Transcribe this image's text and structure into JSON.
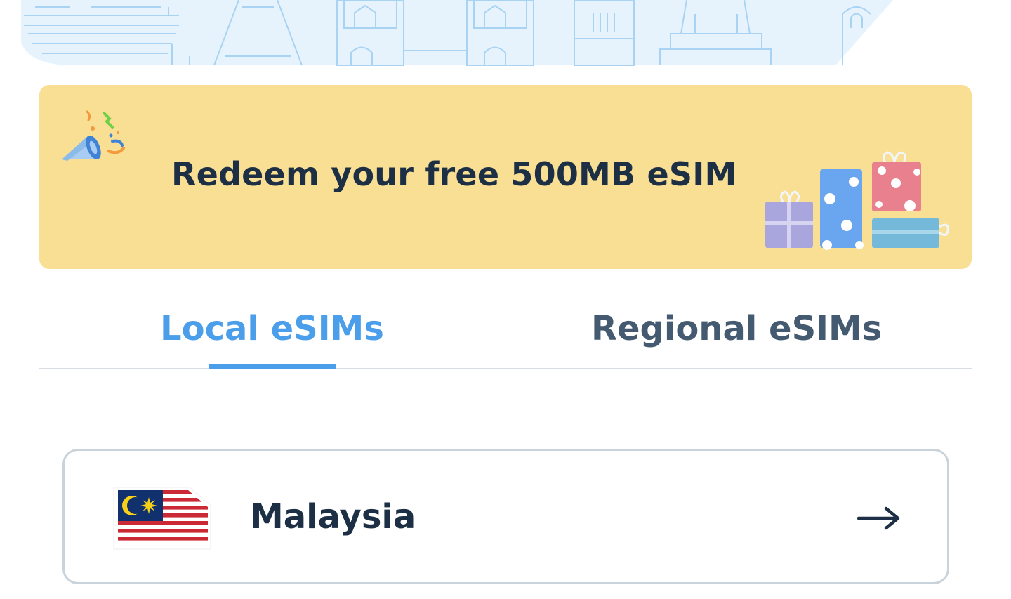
{
  "promo": {
    "title": "Redeem your free 500MB eSIM"
  },
  "tabs": [
    {
      "label": "Local eSIMs",
      "active": true
    },
    {
      "label": "Regional eSIMs",
      "active": false
    }
  ],
  "countries": [
    {
      "name": "Malaysia",
      "flag": "malaysia-flag"
    }
  ],
  "colors": {
    "accent": "#4a9eea",
    "banner": "#f8df94",
    "text_dark": "#1d2f44",
    "tab_inactive": "#445a70",
    "hero_bg": "#e6f3fd"
  },
  "icons": {
    "banner_left": "megaphone-icon",
    "banner_right": "gift-boxes-icon",
    "card_action": "arrow-right-icon"
  }
}
